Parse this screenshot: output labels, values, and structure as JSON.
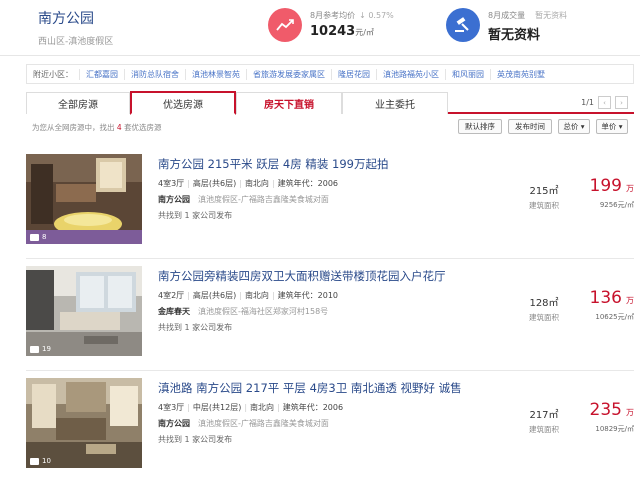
{
  "header": {
    "title": "南方公园",
    "subtitle": "西山区-滇池度假区",
    "avg_price": {
      "label": "8月参考均价",
      "delta": "↓ 0.57%",
      "value": "10243",
      "unit": "元/㎡",
      "icon": "chart-line-icon",
      "color": "#f05b6a"
    },
    "deals": {
      "label": "8月成交量",
      "note": "暂无资料",
      "value": "暂无资料",
      "icon": "gavel-icon",
      "color": "#3b6fd1"
    }
  },
  "nearby": {
    "label": "附近小区：",
    "items": [
      "汇都嘉园",
      "消防总队宿舍",
      "滇池林景智苑",
      "省旅游发展委家属区",
      "隆居花园",
      "滇池路福苑小区",
      "和风丽园",
      "英茂南苑别墅"
    ]
  },
  "tabs": [
    {
      "label": "全部房源"
    },
    {
      "label": "优选房源"
    },
    {
      "label": "房天下直销"
    },
    {
      "label": "业主委托"
    }
  ],
  "pager": {
    "text": "1/1",
    "prev": "‹",
    "next": "›"
  },
  "sort": {
    "info_prefix": "为您从全网房源中，找出",
    "count": "4",
    "info_suffix": "套优选房源",
    "buttons": [
      "默认排序",
      "发布时间",
      "总价 ▾",
      "单价 ▾"
    ]
  },
  "listings": [
    {
      "title": "南方公园 215平米 跃层 4房 精装 199万起拍",
      "rooms": "4室3厅",
      "floor": "高层(共6层)",
      "orientation": "南北向",
      "year": "建筑年代：2006",
      "community": "南方公园",
      "address": "滇池度假区-广福路吉鑫隆美食城对面",
      "agents": "共找到 1 家公司发布",
      "area": "215㎡",
      "area_label": "建筑面积",
      "price": "199",
      "price_unit": "万",
      "unit_price": "9256元/㎡",
      "photos": "8"
    },
    {
      "title": "南方公园旁精装四房双卫大面积赠送带楼顶花园入户花厅",
      "rooms": "4室2厅",
      "floor": "高层(共6层)",
      "orientation": "南北向",
      "year": "建筑年代：2010",
      "community": "金库春天",
      "address": "滇池度假区-福海社区郑家河村158号",
      "agents": "共找到 1 家公司发布",
      "area": "128㎡",
      "area_label": "建筑面积",
      "price": "136",
      "price_unit": "万",
      "unit_price": "10625元/㎡",
      "photos": "19"
    },
    {
      "title": "滇池路 南方公园 217平 平层 4房3卫 南北通透 视野好 诚售",
      "rooms": "4室3厅",
      "floor": "中层(共12层)",
      "orientation": "南北向",
      "year": "建筑年代：2006",
      "community": "南方公园",
      "address": "滇池度假区-广福路吉鑫隆美食城对面",
      "agents": "共找到 1 家公司发布",
      "area": "217㎡",
      "area_label": "建筑面积",
      "price": "235",
      "price_unit": "万",
      "unit_price": "10829元/㎡",
      "photos": "10"
    }
  ],
  "colors": {
    "accent": "#c7122c",
    "link": "#2a4a8a"
  }
}
